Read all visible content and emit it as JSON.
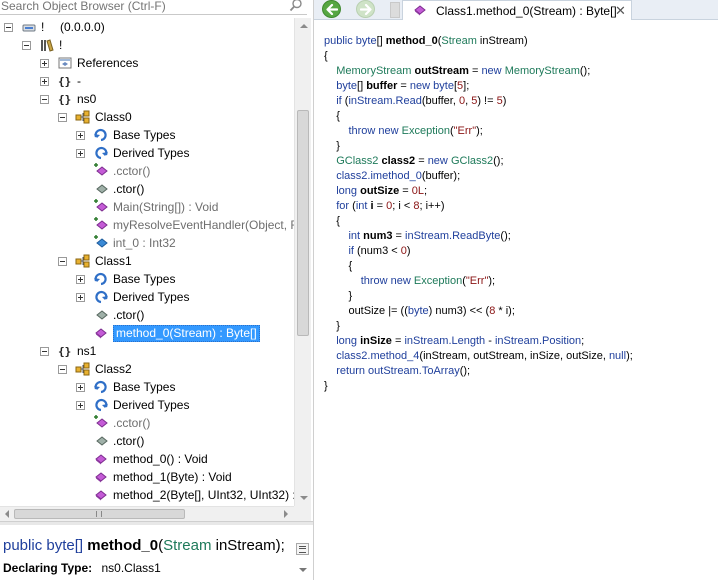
{
  "search": {
    "placeholder": "Search Object Browser (Ctrl-F)"
  },
  "tree": [
    {
      "label": "!",
      "suffix": "(0.0.0.0)",
      "icon": "assembly-icon",
      "expander": "minus"
    },
    {
      "label": "!",
      "icon": "library-icon",
      "expander": "minus"
    },
    {
      "label": "References",
      "icon": "references-icon",
      "expander": "plus"
    },
    {
      "label": "-",
      "icon": "namespace-icon",
      "expander": "plus"
    },
    {
      "label": "ns0",
      "icon": "namespace-icon",
      "expander": "minus"
    },
    {
      "label": "Class0",
      "icon": "class-icon",
      "expander": "minus"
    },
    {
      "label": "Base Types",
      "icon": "base-types-icon",
      "expander": "plus"
    },
    {
      "label": "Derived Types",
      "icon": "derived-types-icon",
      "expander": "plus"
    },
    {
      "label": ".cctor()",
      "icon": "static-method-icon"
    },
    {
      "label": ".ctor()",
      "icon": "constructor-icon"
    },
    {
      "label": "Main(String[]) : Void",
      "icon": "static-method-icon"
    },
    {
      "label": "myResolveEventHandler(Object, R",
      "icon": "static-method-icon"
    },
    {
      "label": "int_0 : Int32",
      "icon": "field-icon"
    },
    {
      "label": "Class1",
      "icon": "class-icon",
      "expander": "minus"
    },
    {
      "label": "Base Types",
      "icon": "base-types-icon",
      "expander": "plus"
    },
    {
      "label": "Derived Types",
      "icon": "derived-types-icon",
      "expander": "plus"
    },
    {
      "label": ".ctor()",
      "icon": "constructor-icon"
    },
    {
      "label": "method_0(Stream) : Byte[]",
      "icon": "method-icon",
      "selected": true
    },
    {
      "label": "ns1",
      "icon": "namespace-icon",
      "expander": "minus"
    },
    {
      "label": "Class2",
      "icon": "class-icon",
      "expander": "minus"
    },
    {
      "label": "Base Types",
      "icon": "base-types-icon",
      "expander": "plus"
    },
    {
      "label": "Derived Types",
      "icon": "derived-types-icon",
      "expander": "plus"
    },
    {
      "label": ".cctor()",
      "icon": "static-method-icon"
    },
    {
      "label": ".ctor()",
      "icon": "constructor-icon"
    },
    {
      "label": "method_0() : Void",
      "icon": "method-icon"
    },
    {
      "label": "method_1(Byte) : Void",
      "icon": "method-icon"
    },
    {
      "label": "method_2(Byte[], UInt32, UInt32) :",
      "icon": "method-icon"
    }
  ],
  "description": {
    "signature": {
      "kw1": "public",
      "kw2": "byte[]",
      "name": "method_0",
      "open": "(",
      "type": "Stream",
      "param": " inStream);"
    },
    "declaring_label": "Declaring Type:",
    "declaring_value": "ns0.Class1"
  },
  "toolbar": {
    "back_icon": "back-arrow-icon",
    "forward_icon": "forward-arrow-icon",
    "tab_label": "Class1.method_0(Stream) : Byte[]",
    "tab_close": "✕"
  },
  "code": [
    [
      [
        "kw",
        "public "
      ],
      [
        "kw",
        "byte"
      ],
      [
        "pl",
        "[] "
      ],
      [
        "b",
        "method_0"
      ],
      [
        "pl",
        "("
      ],
      [
        "ty",
        "Stream"
      ],
      [
        "pl",
        " inStream)"
      ]
    ],
    [
      [
        "pl",
        "{"
      ]
    ],
    [
      [
        "pl",
        "    "
      ],
      [
        "ty",
        "MemoryStream "
      ],
      [
        "b",
        "outStream"
      ],
      [
        "pl",
        " = "
      ],
      [
        "kw",
        "new "
      ],
      [
        "ty",
        "MemoryStream"
      ],
      [
        "pl",
        "();"
      ]
    ],
    [
      [
        "pl",
        "    "
      ],
      [
        "kw",
        "byte"
      ],
      [
        "pl",
        "[] "
      ],
      [
        "b",
        "buffer"
      ],
      [
        "pl",
        " = "
      ],
      [
        "kw",
        "new "
      ],
      [
        "kw",
        "byte"
      ],
      [
        "pl",
        "["
      ],
      [
        "num",
        "5"
      ],
      [
        "pl",
        "];"
      ]
    ],
    [
      [
        "pl",
        "    "
      ],
      [
        "kw",
        "if "
      ],
      [
        "pl",
        "("
      ],
      [
        "nm",
        "inStream.Read"
      ],
      [
        "pl",
        "(buffer, "
      ],
      [
        "num",
        "0"
      ],
      [
        "pl",
        ", "
      ],
      [
        "num",
        "5"
      ],
      [
        "pl",
        ") != "
      ],
      [
        "num",
        "5"
      ],
      [
        "pl",
        ")"
      ]
    ],
    [
      [
        "pl",
        "    {"
      ]
    ],
    [
      [
        "pl",
        "        "
      ],
      [
        "kw",
        "throw new "
      ],
      [
        "ty",
        "Exception"
      ],
      [
        "pl",
        "("
      ],
      [
        "str",
        "\"Err\""
      ],
      [
        "pl",
        ");"
      ]
    ],
    [
      [
        "pl",
        "    }"
      ]
    ],
    [
      [
        "pl",
        "    "
      ],
      [
        "ty",
        "GClass2 "
      ],
      [
        "b",
        "class2"
      ],
      [
        "pl",
        " = "
      ],
      [
        "kw",
        "new "
      ],
      [
        "ty",
        "GClass2"
      ],
      [
        "pl",
        "();"
      ]
    ],
    [
      [
        "pl",
        "    "
      ],
      [
        "nm",
        "class2.imethod_0"
      ],
      [
        "pl",
        "(buffer);"
      ]
    ],
    [
      [
        "pl",
        "    "
      ],
      [
        "kw",
        "long "
      ],
      [
        "b",
        "outSize"
      ],
      [
        "pl",
        " = "
      ],
      [
        "num",
        "0L"
      ],
      [
        "pl",
        ";"
      ]
    ],
    [
      [
        "pl",
        "    "
      ],
      [
        "kw",
        "for "
      ],
      [
        "pl",
        "("
      ],
      [
        "kw",
        "int "
      ],
      [
        "b",
        "i"
      ],
      [
        "pl",
        " = "
      ],
      [
        "num",
        "0"
      ],
      [
        "pl",
        "; i < "
      ],
      [
        "num",
        "8"
      ],
      [
        "pl",
        "; i++)"
      ]
    ],
    [
      [
        "pl",
        "    {"
      ]
    ],
    [
      [
        "pl",
        "        "
      ],
      [
        "kw",
        "int "
      ],
      [
        "b",
        "num3"
      ],
      [
        "pl",
        " = "
      ],
      [
        "nm",
        "inStream.ReadByte"
      ],
      [
        "pl",
        "();"
      ]
    ],
    [
      [
        "pl",
        "        "
      ],
      [
        "kw",
        "if "
      ],
      [
        "pl",
        "(num3 < "
      ],
      [
        "num",
        "0"
      ],
      [
        "pl",
        ")"
      ]
    ],
    [
      [
        "pl",
        "        {"
      ]
    ],
    [
      [
        "pl",
        "            "
      ],
      [
        "kw",
        "throw new "
      ],
      [
        "ty",
        "Exception"
      ],
      [
        "pl",
        "("
      ],
      [
        "str",
        "\"Err\""
      ],
      [
        "pl",
        ");"
      ]
    ],
    [
      [
        "pl",
        "        }"
      ]
    ],
    [
      [
        "pl",
        "        outSize |= (("
      ],
      [
        "kw",
        "byte"
      ],
      [
        "pl",
        ") num3) << ("
      ],
      [
        "num",
        "8"
      ],
      [
        "pl",
        " * i);"
      ]
    ],
    [
      [
        "pl",
        "    }"
      ]
    ],
    [
      [
        "pl",
        "    "
      ],
      [
        "kw",
        "long "
      ],
      [
        "b",
        "inSize"
      ],
      [
        "pl",
        " = "
      ],
      [
        "nm",
        "inStream.Length"
      ],
      [
        "pl",
        " - "
      ],
      [
        "nm",
        "inStream.Position"
      ],
      [
        "pl",
        ";"
      ]
    ],
    [
      [
        "pl",
        "    "
      ],
      [
        "nm",
        "class2.method_4"
      ],
      [
        "pl",
        "(inStream, outStream, inSize, outSize, "
      ],
      [
        "kw",
        "null"
      ],
      [
        "pl",
        ");"
      ]
    ],
    [
      [
        "pl",
        "    "
      ],
      [
        "kw",
        "return "
      ],
      [
        "nm",
        "outStream.ToArray"
      ],
      [
        "pl",
        "();"
      ]
    ],
    [
      [
        "pl",
        "}"
      ]
    ]
  ],
  "colors": {
    "selection": "#3399ff",
    "keyword": "#1f3f9c",
    "type": "#1e7a5a",
    "string": "#8a1414",
    "back_button": "#56a642"
  }
}
